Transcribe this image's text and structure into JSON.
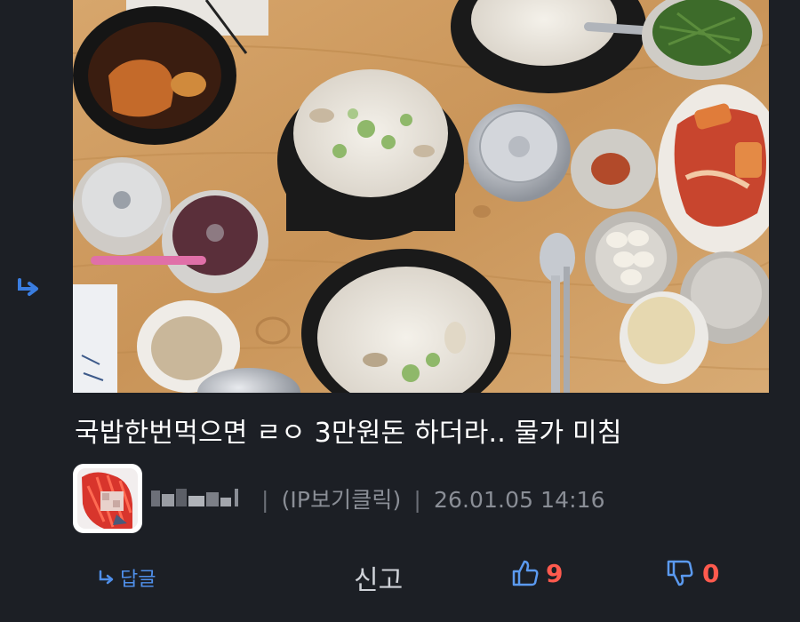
{
  "comment": {
    "text": "국밥한번먹으면 ㄹㅇ 3만원돈 하더라.. 물가 미침",
    "photo_icon": "food-photo"
  },
  "author": {
    "avatar_icon": "avatar",
    "username_icon": "blurred-username",
    "ip_label": "(IP보기클릭)",
    "timestamp": "26.01.05 14:16",
    "separator": "|"
  },
  "actions": {
    "reply_label": "답글",
    "report_label": "신고",
    "like_count": "9",
    "dislike_count": "0"
  },
  "colors": {
    "background": "#1c1f25",
    "accent_blue": "#4f8fea",
    "count_red": "#ff5a4e",
    "meta_gray": "#8a8e96"
  }
}
